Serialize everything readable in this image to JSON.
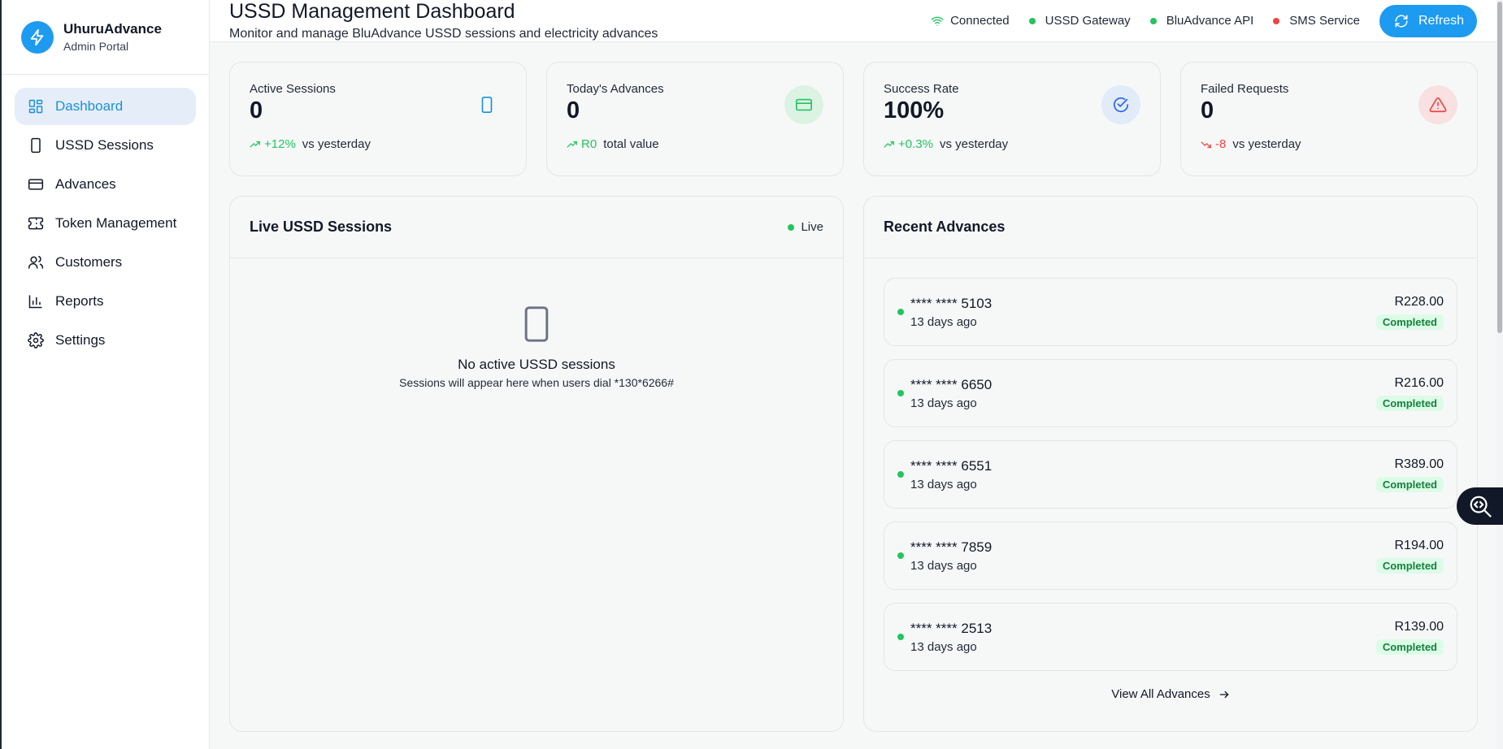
{
  "brand": {
    "name": "UhuruAdvance",
    "subtitle": "Admin Portal",
    "icon": "lightning-icon"
  },
  "nav": [
    {
      "label": "Dashboard",
      "icon": "dashboard-icon",
      "active": true
    },
    {
      "label": "USSD Sessions",
      "icon": "phone-icon"
    },
    {
      "label": "Advances",
      "icon": "credit-card-icon"
    },
    {
      "label": "Token Management",
      "icon": "ticket-icon"
    },
    {
      "label": "Customers",
      "icon": "users-icon"
    },
    {
      "label": "Reports",
      "icon": "bar-chart-icon"
    },
    {
      "label": "Settings",
      "icon": "gear-icon"
    }
  ],
  "header": {
    "title": "USSD Management Dashboard",
    "subtitle": "Monitor and manage BluAdvance USSD sessions and electricity advances",
    "connection": "Connected",
    "services": [
      {
        "label": "USSD Gateway",
        "color": "#22c55e"
      },
      {
        "label": "BluAdvance API",
        "color": "#22c55e"
      },
      {
        "label": "SMS Service",
        "color": "#ef4444"
      }
    ],
    "refresh_label": "Refresh"
  },
  "stats": [
    {
      "label": "Active Sessions",
      "value": "0",
      "trend": "+12%",
      "trend_note": "vs yesterday",
      "trend_dir": "up",
      "icon": "phone-icon"
    },
    {
      "label": "Today's Advances",
      "value": "0",
      "trend": "R0",
      "trend_note": "total value",
      "trend_dir": "up",
      "icon": "credit-card-icon"
    },
    {
      "label": "Success Rate",
      "value": "100%",
      "trend": "+0.3%",
      "trend_note": "vs yesterday",
      "trend_dir": "up",
      "icon": "check-circle-icon"
    },
    {
      "label": "Failed Requests",
      "value": "0",
      "trend": "-8",
      "trend_note": "vs yesterday",
      "trend_dir": "down",
      "icon": "warning-icon"
    }
  ],
  "live": {
    "title": "Live USSD Sessions",
    "badge": "Live",
    "empty_title": "No active USSD sessions",
    "empty_sub": "Sessions will appear here when users dial *130*6266#"
  },
  "recent": {
    "title": "Recent Advances",
    "items": [
      {
        "card": "**** **** 5103",
        "time": "13 days ago",
        "amount": "R228.00",
        "status": "Completed"
      },
      {
        "card": "**** **** 6650",
        "time": "13 days ago",
        "amount": "R216.00",
        "status": "Completed"
      },
      {
        "card": "**** **** 6551",
        "time": "13 days ago",
        "amount": "R389.00",
        "status": "Completed"
      },
      {
        "card": "**** **** 7859",
        "time": "13 days ago",
        "amount": "R194.00",
        "status": "Completed"
      },
      {
        "card": "**** **** 2513",
        "time": "13 days ago",
        "amount": "R139.00",
        "status": "Completed"
      }
    ],
    "view_all": "View All Advances"
  },
  "colors": {
    "accent": "#1d9bf0",
    "success": "#22c55e",
    "danger": "#ef4444"
  }
}
